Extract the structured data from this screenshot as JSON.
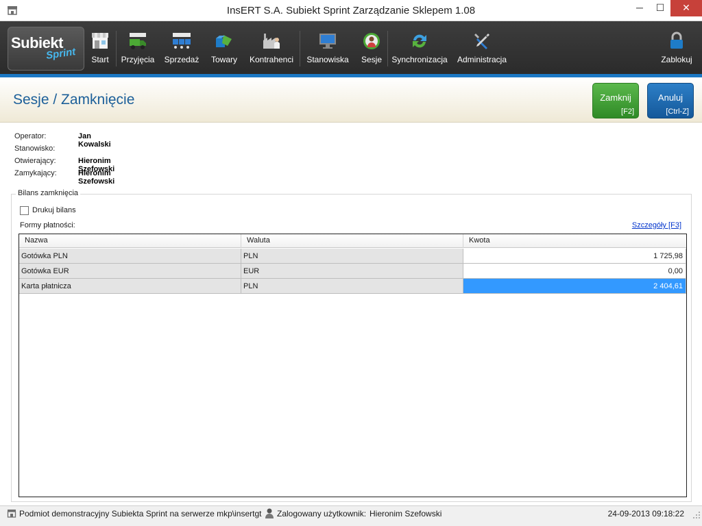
{
  "window": {
    "title": "InsERT S.A. Subiekt Sprint Zarządzanie Sklepem 1.08",
    "icon": "shop-icon",
    "controls": {
      "minimize": "─",
      "maximize": "☐",
      "close": "✕"
    }
  },
  "logo": {
    "main": "Subiekt",
    "sub": "Sprint"
  },
  "toolbar": {
    "items": [
      {
        "label": "Start",
        "icon": "shop-icon"
      },
      {
        "label": "Przyjęcia",
        "icon": "truck-icon"
      },
      {
        "label": "Sprzedaż",
        "icon": "carts-icon"
      },
      {
        "label": "Towary",
        "icon": "boxes-icon"
      },
      {
        "label": "Kontrahenci",
        "icon": "factory-icon"
      },
      {
        "label": "Stanowiska",
        "icon": "monitor-icon"
      },
      {
        "label": "Sesje",
        "icon": "person-clock-icon"
      },
      {
        "label": "Synchronizacja",
        "icon": "sync-icon"
      },
      {
        "label": "Administracja",
        "icon": "tools-icon"
      },
      {
        "label": "Zablokuj",
        "icon": "lock-icon"
      }
    ]
  },
  "header": {
    "title": "Sesje / Zamknięcie",
    "close_button": {
      "label": "Zamknij",
      "shortcut": "[F2]"
    },
    "cancel_button": {
      "label": "Anuluj",
      "shortcut": "[Ctrl-Z]"
    }
  },
  "info": {
    "operator_label": "Operator:",
    "operator_value": "Jan Kowalski",
    "station_label": "Stanowisko:",
    "station_value": "",
    "opening_label": "Otwierający:",
    "opening_value": "Hieronim Szefowski",
    "closing_label": "Zamykający:",
    "closing_value": "Hieronim Szefowski"
  },
  "balance": {
    "legend": "Bilans zamknięcia",
    "print_checkbox_label": "Drukuj bilans",
    "print_checked": false,
    "payment_forms_label": "Formy płatności:",
    "details_link": "Szczegóły [F3]",
    "columns": [
      "Nazwa",
      "Waluta",
      "Kwota"
    ],
    "rows": [
      {
        "name": "Gotówka PLN",
        "currency": "PLN",
        "amount": "1 725,98"
      },
      {
        "name": "Gotówka EUR",
        "currency": "EUR",
        "amount": "0,00"
      },
      {
        "name": "Karta płatnicza",
        "currency": "PLN",
        "amount": "2 404,61"
      }
    ],
    "selected_row": 2
  },
  "statusbar": {
    "company": "Podmiot demonstracyjny Subiekta Sprint na serwerze mkp\\insertgt",
    "user_label": "Zalogowany użytkownik:",
    "user_value": "Hieronim Szefowski",
    "datetime": "24-09-2013 09:18:22"
  },
  "colors": {
    "accent": "#1b78c4",
    "title": "#1c5f99",
    "close_button": "#3d9b32",
    "cancel_button": "#1a67ae",
    "selection": "#3399ff"
  }
}
